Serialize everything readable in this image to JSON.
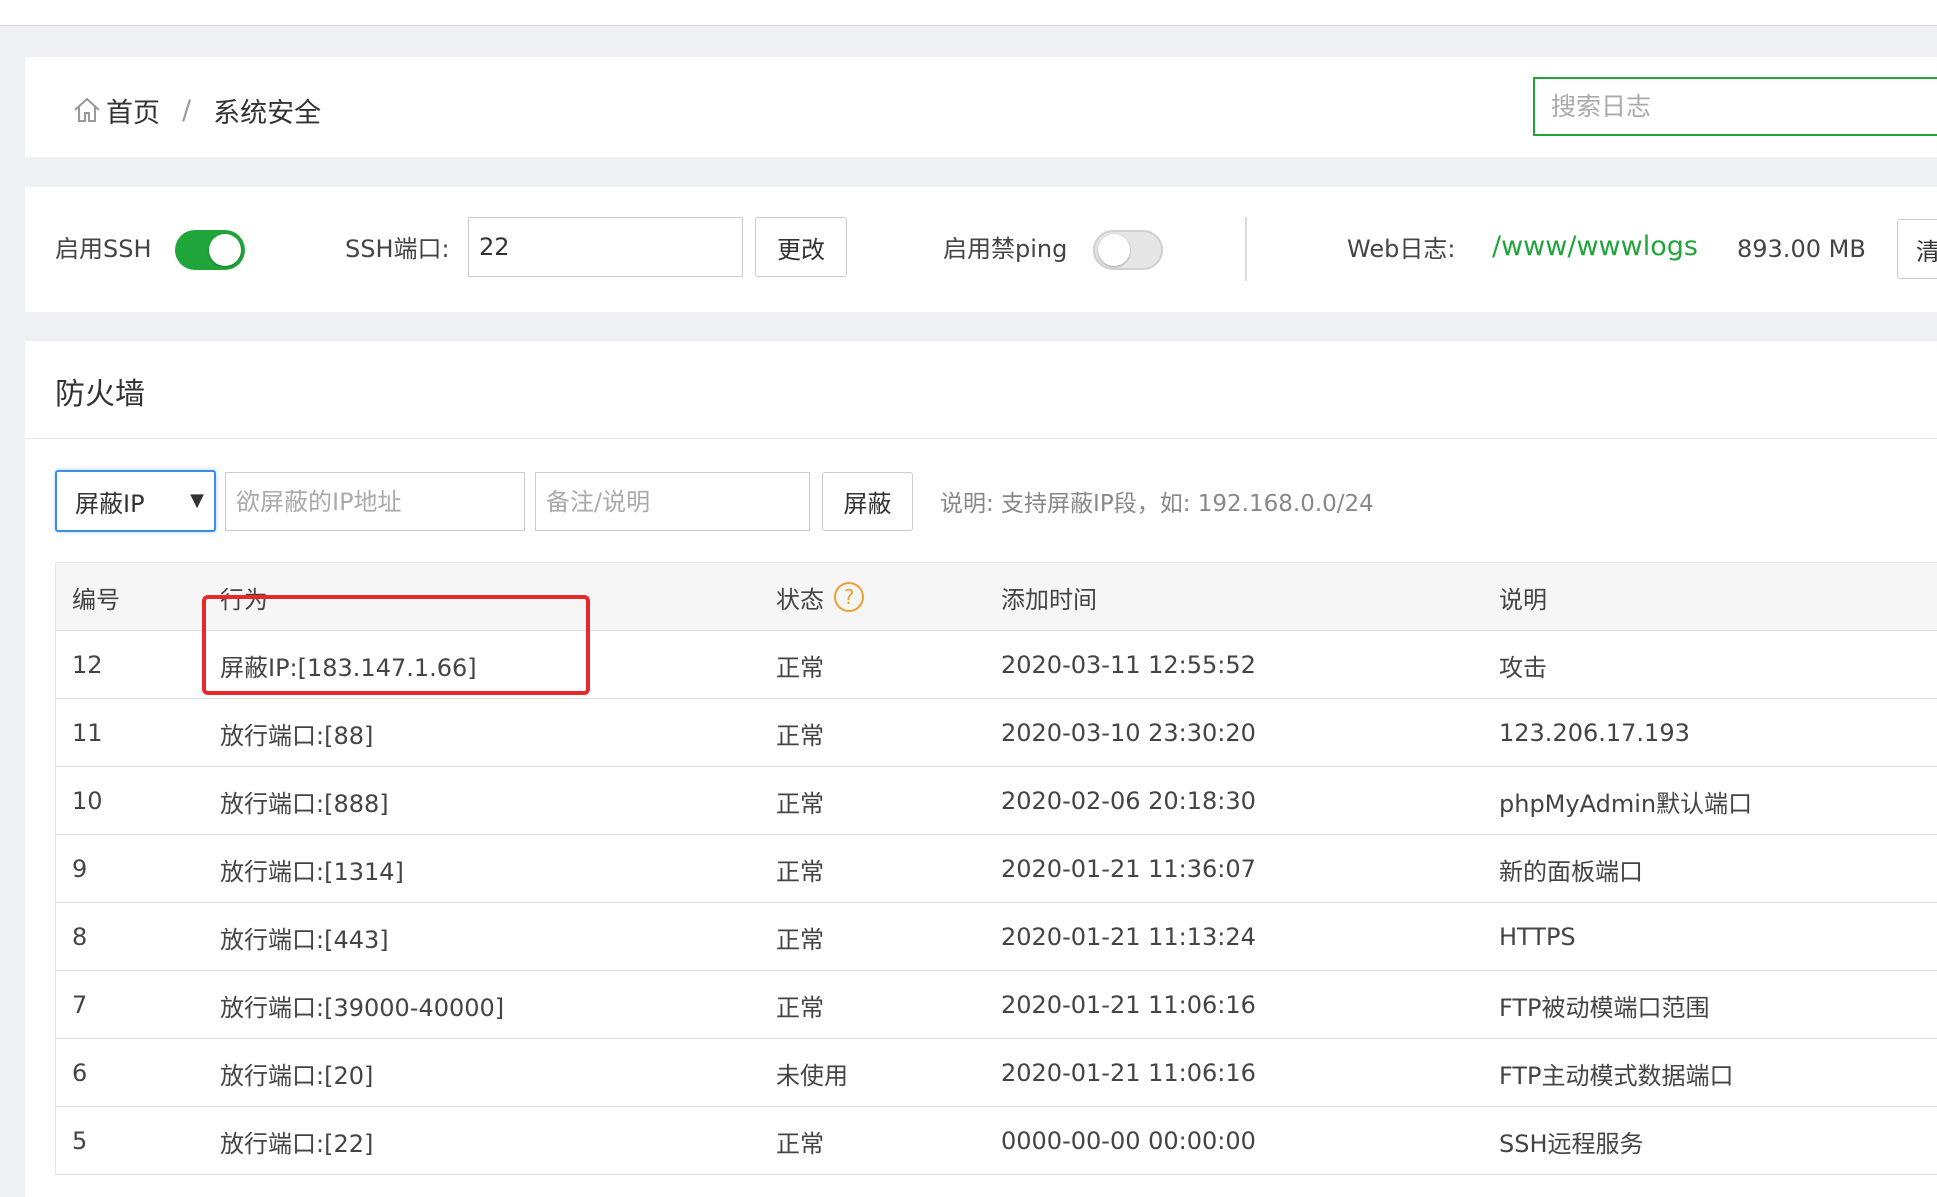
{
  "breadcrumb": {
    "home": "首页",
    "separator": "/",
    "current": "系统安全"
  },
  "search": {
    "placeholder": "搜索日志"
  },
  "settings": {
    "ssh_label": "启用SSH",
    "ssh_enabled": true,
    "ssh_port_label": "SSH端口:",
    "ssh_port_value": "22",
    "change_button": "更改",
    "ping_label": "启用禁ping",
    "ping_enabled": false,
    "weblog_label": "Web日志:",
    "weblog_path": "/www/wwwlogs",
    "weblog_size": "893.00 MB",
    "clear_button_partial": "清"
  },
  "firewall": {
    "title": "防火墙",
    "select_value": "屏蔽IP",
    "ip_placeholder": "欲屏蔽的IP地址",
    "note_placeholder": "备注/说明",
    "block_button": "屏蔽",
    "hint": "说明: 支持屏蔽IP段，如: 192.168.0.0/24",
    "columns": {
      "id": "编号",
      "action": "行为",
      "status": "状态",
      "time": "添加时间",
      "note": "说明"
    },
    "rows": [
      {
        "id": "12",
        "action": "屏蔽IP:[183.147.1.66]",
        "status": "正常",
        "time": "2020-03-11 12:55:52",
        "note": "攻击"
      },
      {
        "id": "11",
        "action": "放行端口:[88]",
        "status": "正常",
        "time": "2020-03-10 23:30:20",
        "note": "123.206.17.193"
      },
      {
        "id": "10",
        "action": "放行端口:[888]",
        "status": "正常",
        "time": "2020-02-06 20:18:30",
        "note": "phpMyAdmin默认端口"
      },
      {
        "id": "9",
        "action": "放行端口:[1314]",
        "status": "正常",
        "time": "2020-01-21 11:36:07",
        "note": "新的面板端口"
      },
      {
        "id": "8",
        "action": "放行端口:[443]",
        "status": "正常",
        "time": "2020-01-21 11:13:24",
        "note": "HTTPS"
      },
      {
        "id": "7",
        "action": "放行端口:[39000-40000]",
        "status": "正常",
        "time": "2020-01-21 11:06:16",
        "note": "FTP被动模端口范围"
      },
      {
        "id": "6",
        "action": "放行端口:[20]",
        "status": "未使用",
        "time": "2020-01-21 11:06:16",
        "note": "FTP主动模式数据端口"
      },
      {
        "id": "5",
        "action": "放行端口:[22]",
        "status": "正常",
        "time": "0000-00-00 00:00:00",
        "note": "SSH远程服务"
      }
    ]
  },
  "icons": {
    "home": "home-icon",
    "help": "help-icon",
    "caret": "chevron-down-icon"
  },
  "colors": {
    "accent": "#20a53a",
    "focus": "#3a8ee6",
    "highlight": "#e8282b",
    "help": "#f0a030"
  }
}
